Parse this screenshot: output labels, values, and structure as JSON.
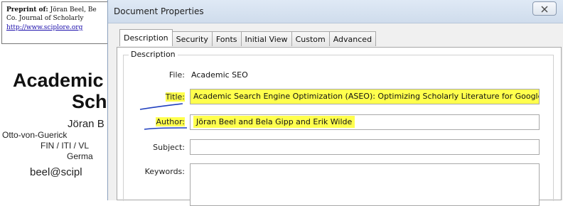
{
  "pdf": {
    "preprint_prefix": "Preprint of:",
    "preprint_author": " Jöran Beel, Be",
    "preprint_line2": "Co. Journal of Scholarly",
    "preprint_link": "http://www.sciplore.org",
    "title_line1": "Academic S",
    "title_line2": "Scho",
    "author_name": "Jöran B",
    "affil1": "Otto-von-Guerick",
    "affil2": "FIN / ITI / VL",
    "affil3": "Germa",
    "email": "beel@scipl"
  },
  "dialog": {
    "title": "Document Properties",
    "tabs": [
      "Description",
      "Security",
      "Fonts",
      "Initial View",
      "Custom",
      "Advanced"
    ],
    "group_label": "Description",
    "fields": {
      "file_label": "File:",
      "file_value": "Academic SEO",
      "title_label": "Title:",
      "title_value": "Academic Search Engine Optimization (ASEO): Optimizing Scholarly Literature for Google Sch",
      "author_label": "Author:",
      "author_value": "Jöran Beel and Bela Gipp and Erik Wilde",
      "subject_label": "Subject:",
      "subject_value": "",
      "keywords_label": "Keywords:",
      "keywords_value": ""
    }
  },
  "colors": {
    "highlight": "#ffff4d",
    "underline": "#1f3fbf",
    "link": "#1a0dab"
  },
  "icons": {
    "close": "close-icon"
  }
}
